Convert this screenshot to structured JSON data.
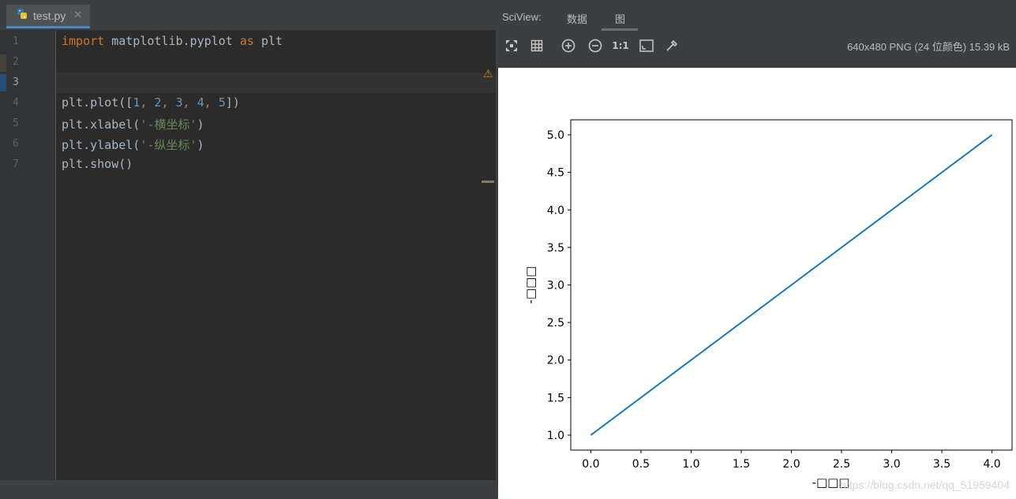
{
  "editor": {
    "tab_name": "test.py",
    "warning_count": "1",
    "line_numbers": [
      "1",
      "2",
      "3",
      "4",
      "5",
      "6",
      "7"
    ],
    "code": {
      "l1_kw1": "import",
      "l1_mid": " matplotlib.pyplot ",
      "l1_kw2": "as",
      "l1_end": " plt",
      "l4_a": "plt.plot([",
      "l4_n1": "1",
      "l4_n2": "2",
      "l4_n3": "3",
      "l4_n4": "4",
      "l4_n5": "5",
      "l4_sep": ", ",
      "l4_end": "])",
      "l5_a": "plt.xlabel(",
      "l5_s": "'-横坐标'",
      "l5_e": ")",
      "l6_a": "plt.ylabel(",
      "l6_s": "'-纵坐标'",
      "l6_e": ")",
      "l7": "plt.show()"
    }
  },
  "sciview": {
    "title": "SciView:",
    "tabs": [
      "数据",
      "图"
    ],
    "image_info": "640x480 PNG (24 位颜色) 15.39 kB",
    "watermark": "https://blog.csdn.net/qq_51959404"
  },
  "chart_data": {
    "type": "line",
    "x": [
      0,
      1,
      2,
      3,
      4
    ],
    "series": [
      {
        "values": [
          1,
          2,
          3,
          4,
          5
        ],
        "color": "#1f77b4"
      }
    ],
    "xlabel": "-□□□",
    "ylabel": "-□□□",
    "xlim": [
      -0.2,
      4.2
    ],
    "ylim": [
      0.8,
      5.2
    ],
    "xticks": [
      "0.0",
      "0.5",
      "1.0",
      "1.5",
      "2.0",
      "2.5",
      "3.0",
      "3.5",
      "4.0"
    ],
    "yticks": [
      "1.0",
      "1.5",
      "2.0",
      "2.5",
      "3.0",
      "3.5",
      "4.0",
      "4.5",
      "5.0"
    ]
  }
}
